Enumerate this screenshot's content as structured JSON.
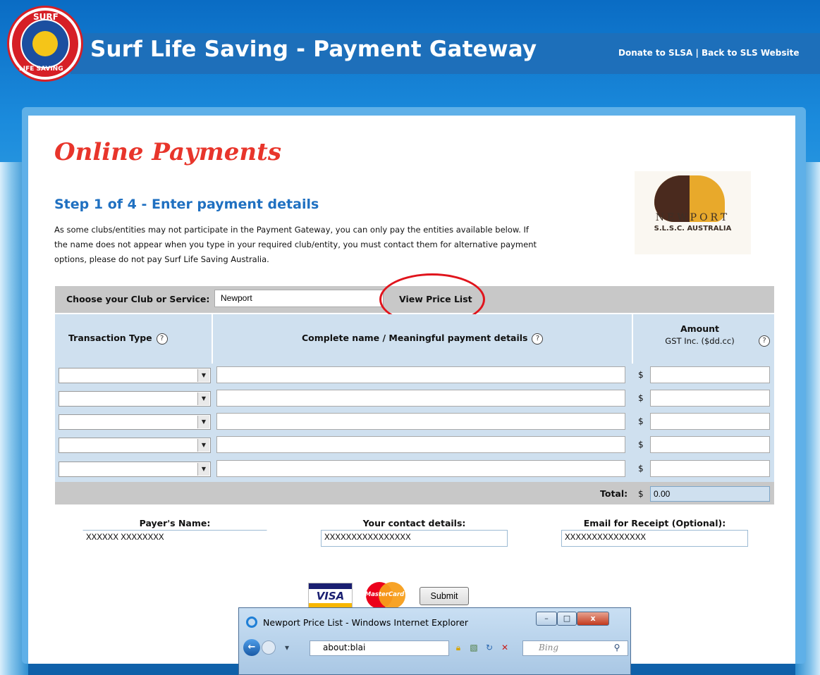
{
  "header": {
    "title": "Surf Life Saving - Payment Gateway",
    "links": [
      "Donate to SLSA",
      "Back to SLS Website"
    ],
    "link_separator": " | ",
    "logo_text_top": "SURF",
    "logo_text_bottom": "LIFE SAVING"
  },
  "page": {
    "heading": "Online Payments",
    "step_title": "Step 1 of 4 - Enter payment details",
    "intro_lines": [
      "As some clubs/entities may not participate in the Payment Gateway, you can only pay the entities available below. If",
      "the name does not appear when you type in your required club/entity, you must contact them for alternative payment",
      "options, please do not pay Surf Life Saving Australia."
    ]
  },
  "club_logo": {
    "name": "NEWPORT",
    "sub": "S.L.S.C. AUSTRALIA"
  },
  "club_chooser": {
    "label": "Choose your Club or Service:",
    "value": "Newport",
    "view_price_label": "View Price List"
  },
  "table": {
    "col_type": "Transaction Type",
    "col_details": "Complete name / Meaningful payment details",
    "col_amount_1": "Amount",
    "col_amount_2": "GST Inc. ($dd.cc)",
    "help_glyph": "?",
    "currency": "$",
    "rows": [
      {
        "type": "",
        "details": "",
        "amount": ""
      },
      {
        "type": "",
        "details": "",
        "amount": ""
      },
      {
        "type": "",
        "details": "",
        "amount": ""
      },
      {
        "type": "",
        "details": "",
        "amount": ""
      },
      {
        "type": "",
        "details": "",
        "amount": ""
      }
    ],
    "total_label": "Total:",
    "total_value": "0.00"
  },
  "payer": {
    "name_label": "Payer's Name:",
    "name_value": "XXXXXX XXXXXXXX",
    "contact_label": "Your contact details:",
    "contact_value": "XXXXXXXXXXXXXXXX",
    "email_label": "Email for Receipt (Optional):",
    "email_value": "XXXXXXXXXXXXXXX"
  },
  "payment": {
    "visa_label": "VISA",
    "mastercard_label": "MasterCard",
    "submit_label": "Submit"
  },
  "popup": {
    "title": "Newport Price List - Windows Internet Explorer",
    "address": "about:blai",
    "search_placeholder": "Bing",
    "minimize": "–",
    "maximize": "□",
    "close": "x"
  },
  "colors": {
    "brand_blue": "#1f70c1",
    "heading_red": "#e8352b",
    "header_bar": "#1f6fb8",
    "annotation_red": "#e0141c"
  }
}
